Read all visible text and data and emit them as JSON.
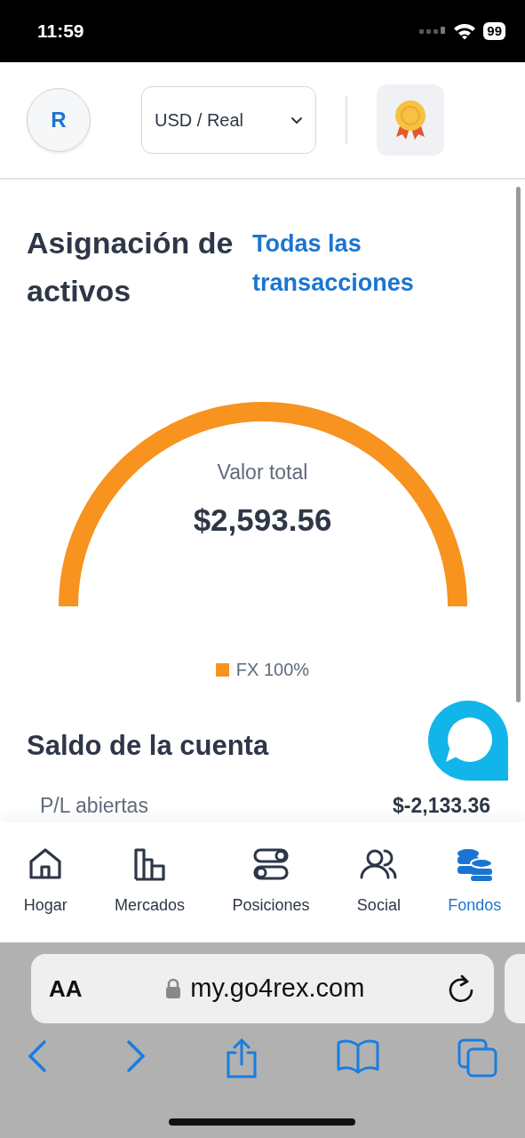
{
  "status_bar": {
    "time": "11:59",
    "battery": "99"
  },
  "header": {
    "avatar": "R",
    "account_select": "USD / Real"
  },
  "allocation": {
    "title": "Asignación de activos",
    "link": "Todas las transacciones",
    "gauge_label": "Valor total",
    "gauge_value": "$2,593.56",
    "legend": [
      {
        "label": "FX 100%",
        "color": "#f7931e"
      }
    ]
  },
  "balance": {
    "title": "Saldo de la cuenta",
    "rows": [
      {
        "label": "P/L abiertas",
        "value": "$-2,133.36"
      }
    ]
  },
  "bottom_nav": [
    {
      "label": "Hogar",
      "kind": "home",
      "selected": false
    },
    {
      "label": "Mercados",
      "kind": "markets",
      "selected": false
    },
    {
      "label": "Posiciones",
      "kind": "positions",
      "selected": false
    },
    {
      "label": "Social",
      "kind": "social",
      "selected": false
    },
    {
      "label": "Fondos",
      "kind": "funds",
      "selected": true
    }
  ],
  "browser": {
    "text_size": "AA",
    "url": "my.go4rex.com"
  }
}
